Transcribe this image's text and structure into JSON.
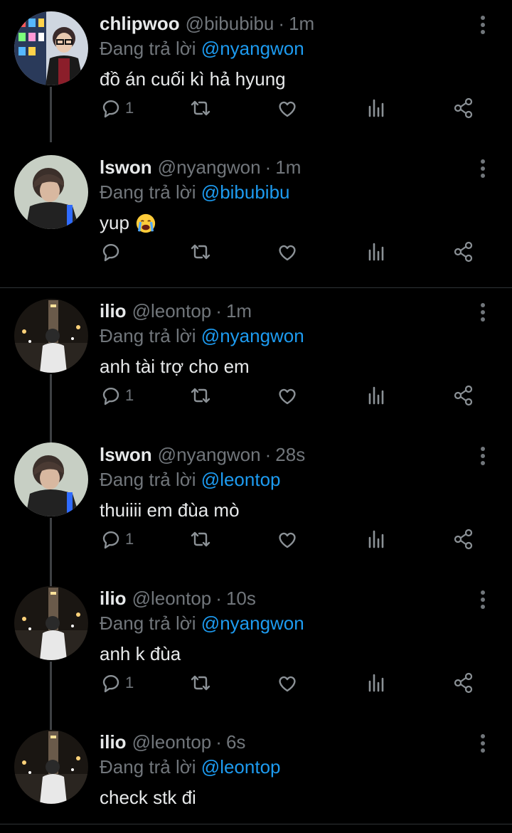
{
  "reply_prefix": "Đang trả lời",
  "tweets": [
    {
      "name": "chlipwoo",
      "handle": "@bibubibu",
      "time": "1m",
      "reply_to": "@nyangwon",
      "text": "đồ án cuối kì hả hyung",
      "reply_count": "1",
      "avatar": "avatar-chlipwoo"
    },
    {
      "name": "lswon",
      "handle": "@nyangwon",
      "time": "1m",
      "reply_to": "@bibubibu",
      "text": "yup",
      "reply_count": "",
      "avatar": "avatar-lswon",
      "emoji": "loudly-crying-face-emoji"
    },
    {
      "name": "ilio",
      "handle": "@leontop",
      "time": "1m",
      "reply_to": "@nyangwon",
      "text": "anh tài trợ cho em",
      "reply_count": "1",
      "avatar": "avatar-ilio"
    },
    {
      "name": "lswon",
      "handle": "@nyangwon",
      "time": "28s",
      "reply_to": "@leontop",
      "text": "thuiiii em đùa mò",
      "reply_count": "1",
      "avatar": "avatar-lswon"
    },
    {
      "name": "ilio",
      "handle": "@leontop",
      "time": "10s",
      "reply_to": "@nyangwon",
      "text": "anh k đùa",
      "reply_count": "1",
      "avatar": "avatar-ilio"
    },
    {
      "name": "ilio",
      "handle": "@leontop",
      "time": "6s",
      "reply_to": "@leontop",
      "text": "check stk đi",
      "reply_count": "",
      "avatar": "avatar-ilio"
    }
  ],
  "colors": {
    "background": "#000000",
    "text": "#e7e9ea",
    "secondary": "#71767b",
    "link": "#1d9bf0",
    "divider": "#2f3336"
  }
}
